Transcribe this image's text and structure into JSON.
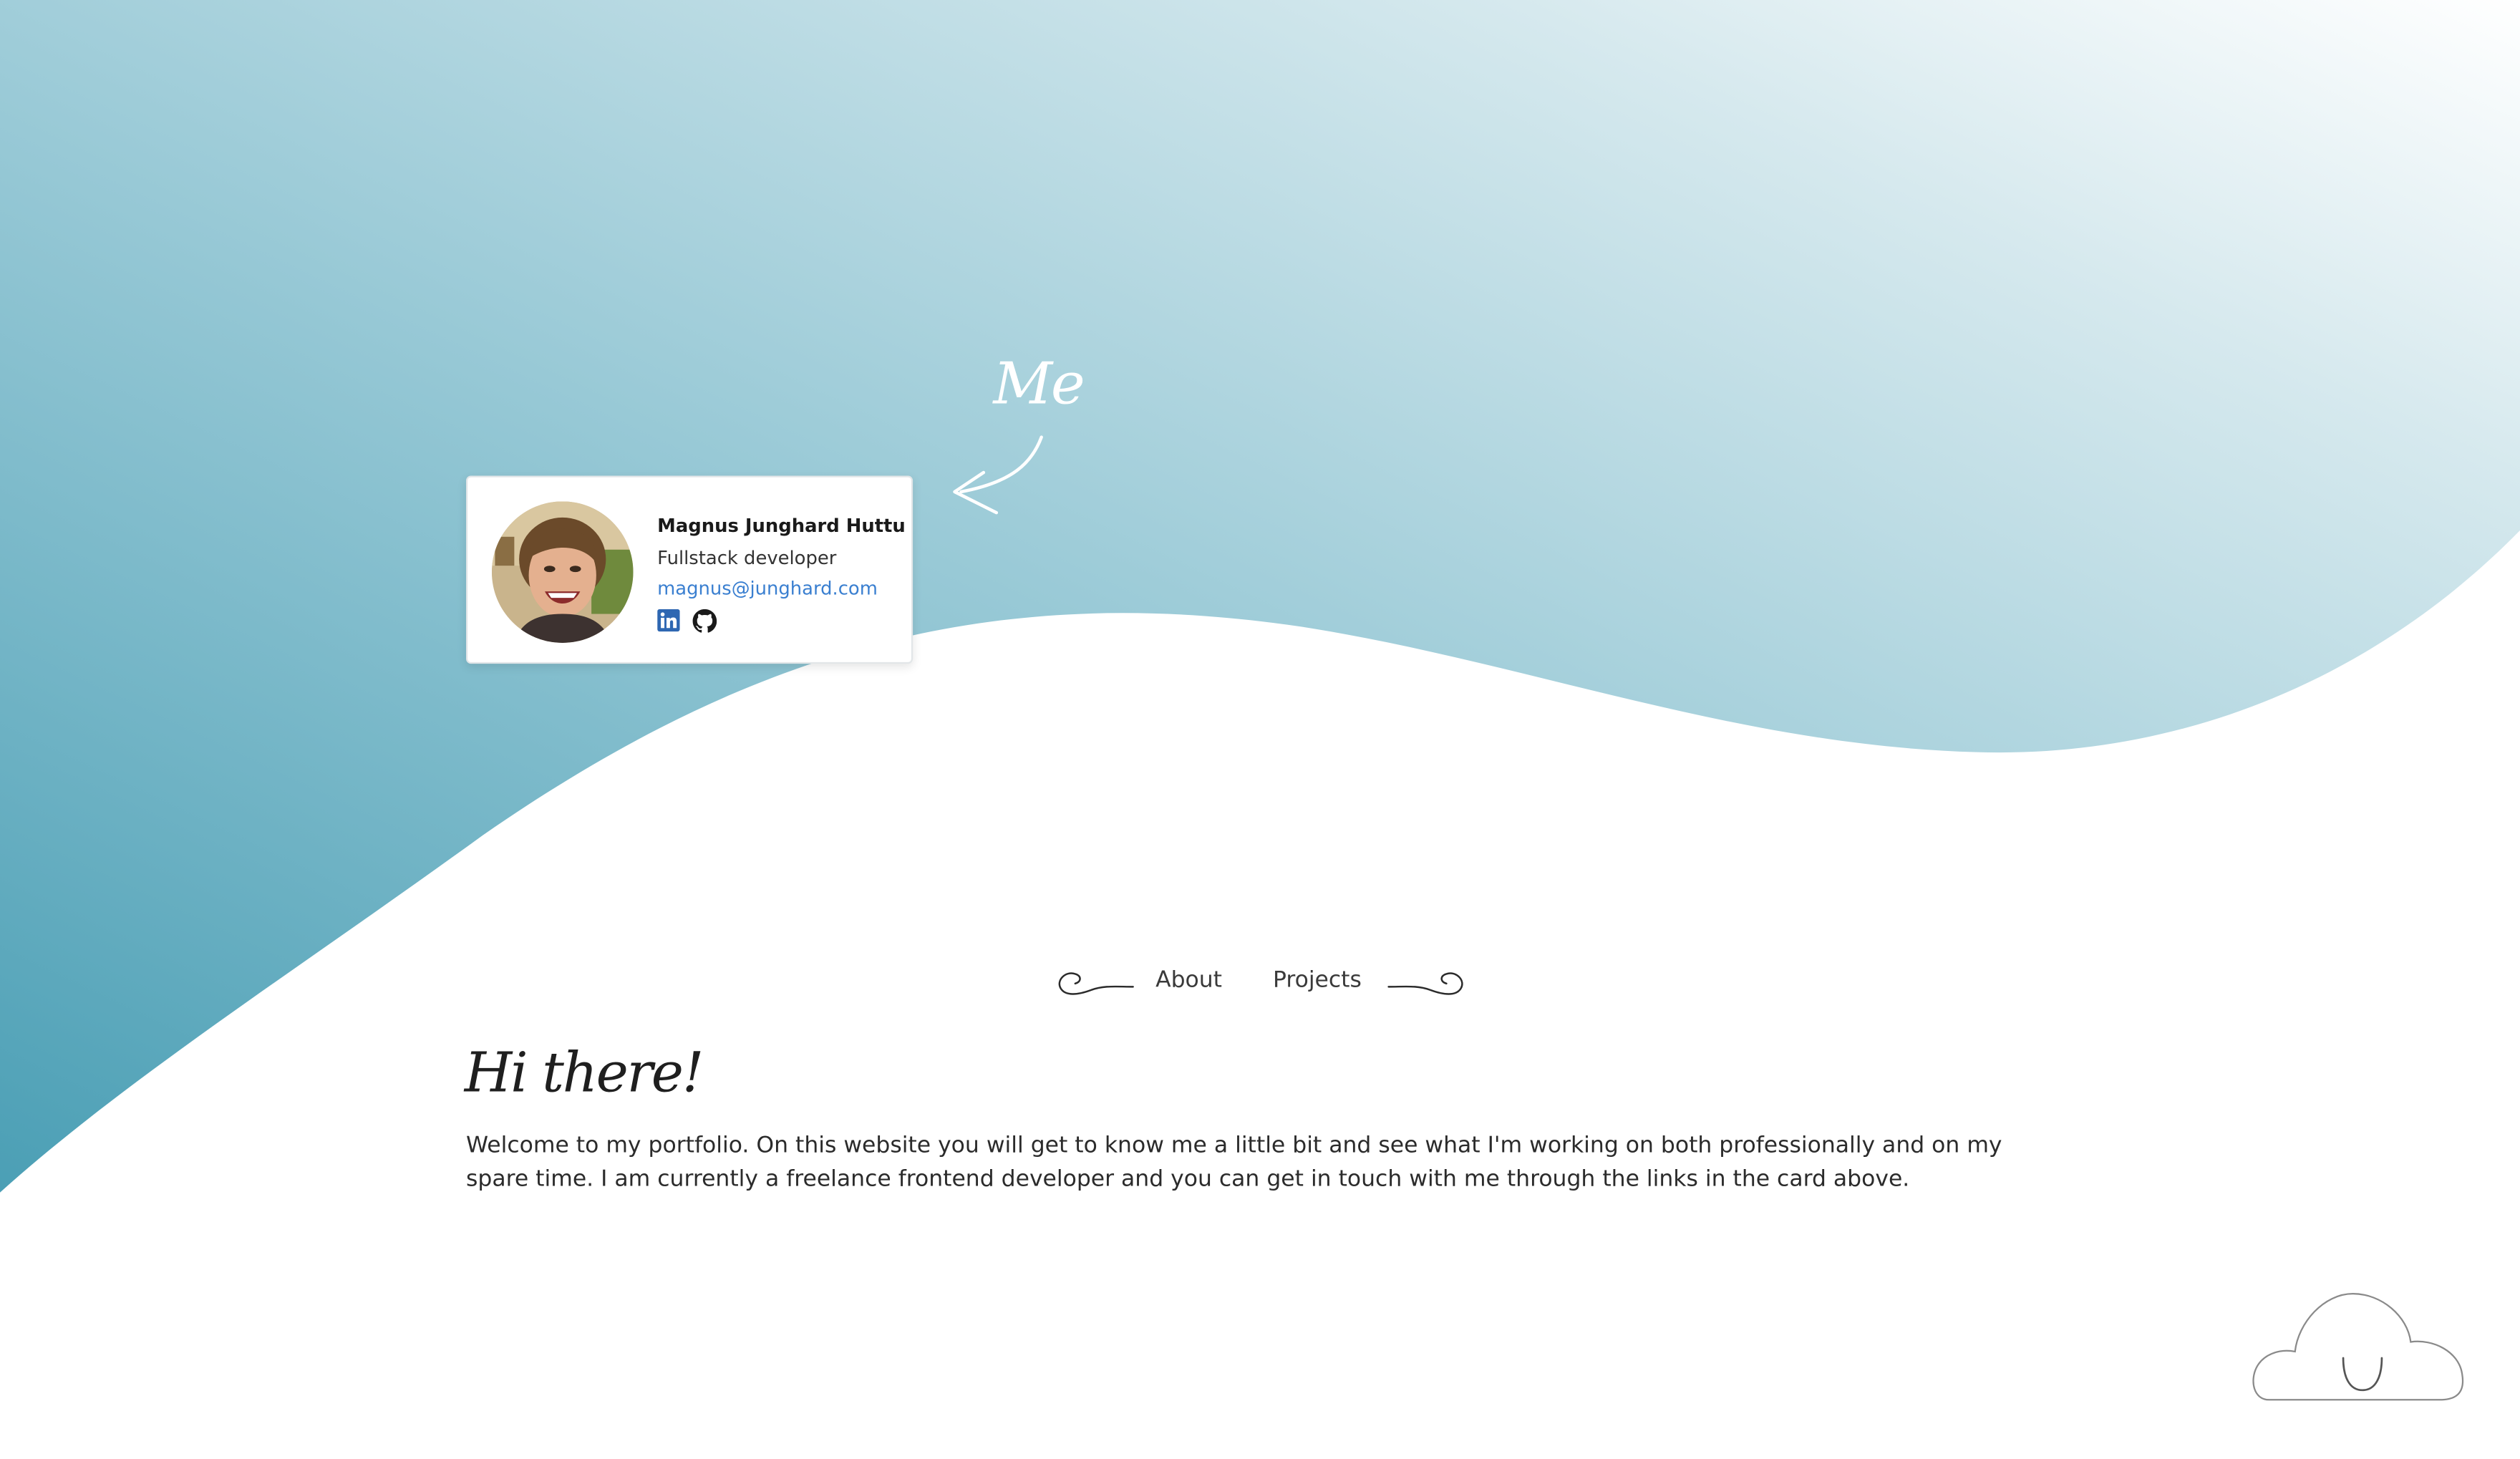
{
  "hero": {
    "label": "Me",
    "gradient_start": "#4fa3b8",
    "gradient_end": "#ffffff"
  },
  "card": {
    "name": "Magnus Junghard Huttu",
    "role": "Fullstack developer",
    "email": "magnus@junghard.com",
    "email_color": "#3a7fd0",
    "social": [
      {
        "icon": "linkedin-icon",
        "color": "#2e67b2"
      },
      {
        "icon": "github-icon",
        "color": "#1a1a1a"
      }
    ]
  },
  "nav": {
    "items": [
      {
        "label": "About"
      },
      {
        "label": "Projects"
      }
    ]
  },
  "main": {
    "greeting": "Hi there!",
    "intro": "Welcome to my portfolio. On this website you will get to know me a little bit and see what I'm working on both professionally and on my spare time. I am currently a freelance frontend developer and you can get in touch with me through the links in the card above."
  },
  "footer": {
    "icon": "cloud-icon"
  }
}
